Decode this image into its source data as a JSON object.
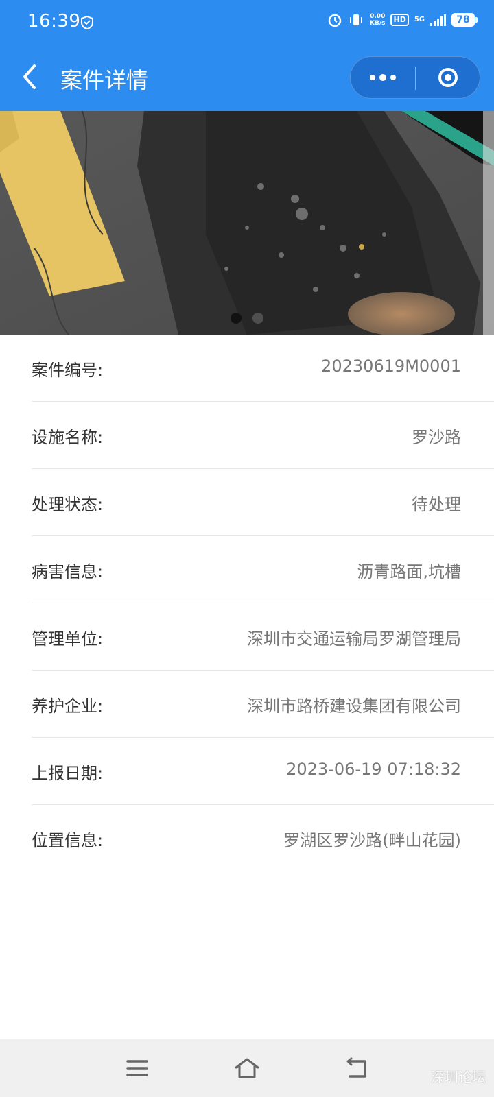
{
  "status_bar": {
    "time": "16:39",
    "net_speed_value": "0.00",
    "net_speed_unit": "KB/s",
    "hd": "HD",
    "network": "5G",
    "battery": "78"
  },
  "header": {
    "title": "案件详情"
  },
  "carousel": {
    "total_slides": 2,
    "active_index": 1
  },
  "details": {
    "case_no": {
      "label": "案件编号:",
      "value": "20230619M0001"
    },
    "facility": {
      "label": "设施名称:",
      "value": "罗沙路"
    },
    "status": {
      "label": "处理状态:",
      "value": "待处理"
    },
    "defect": {
      "label": "病害信息:",
      "value": "沥青路面,坑槽"
    },
    "management_unit": {
      "label": "管理单位:",
      "value": "深圳市交通运输局罗湖管理局"
    },
    "maintenance_company": {
      "label": "养护企业:",
      "value": "深圳市路桥建设集团有限公司"
    },
    "report_date": {
      "label": "上报日期:",
      "value": "2023-06-19 07:18:32"
    },
    "location": {
      "label": "位置信息:",
      "value": "罗湖区罗沙路(畔山花园)"
    }
  },
  "watermark": "深圳论坛",
  "colors": {
    "header_bg": "#2d8cf0",
    "capsule_bg": "#1f6fd1",
    "label_text": "#333333",
    "value_text": "#777777",
    "nav_bg": "#f0f0f0"
  }
}
